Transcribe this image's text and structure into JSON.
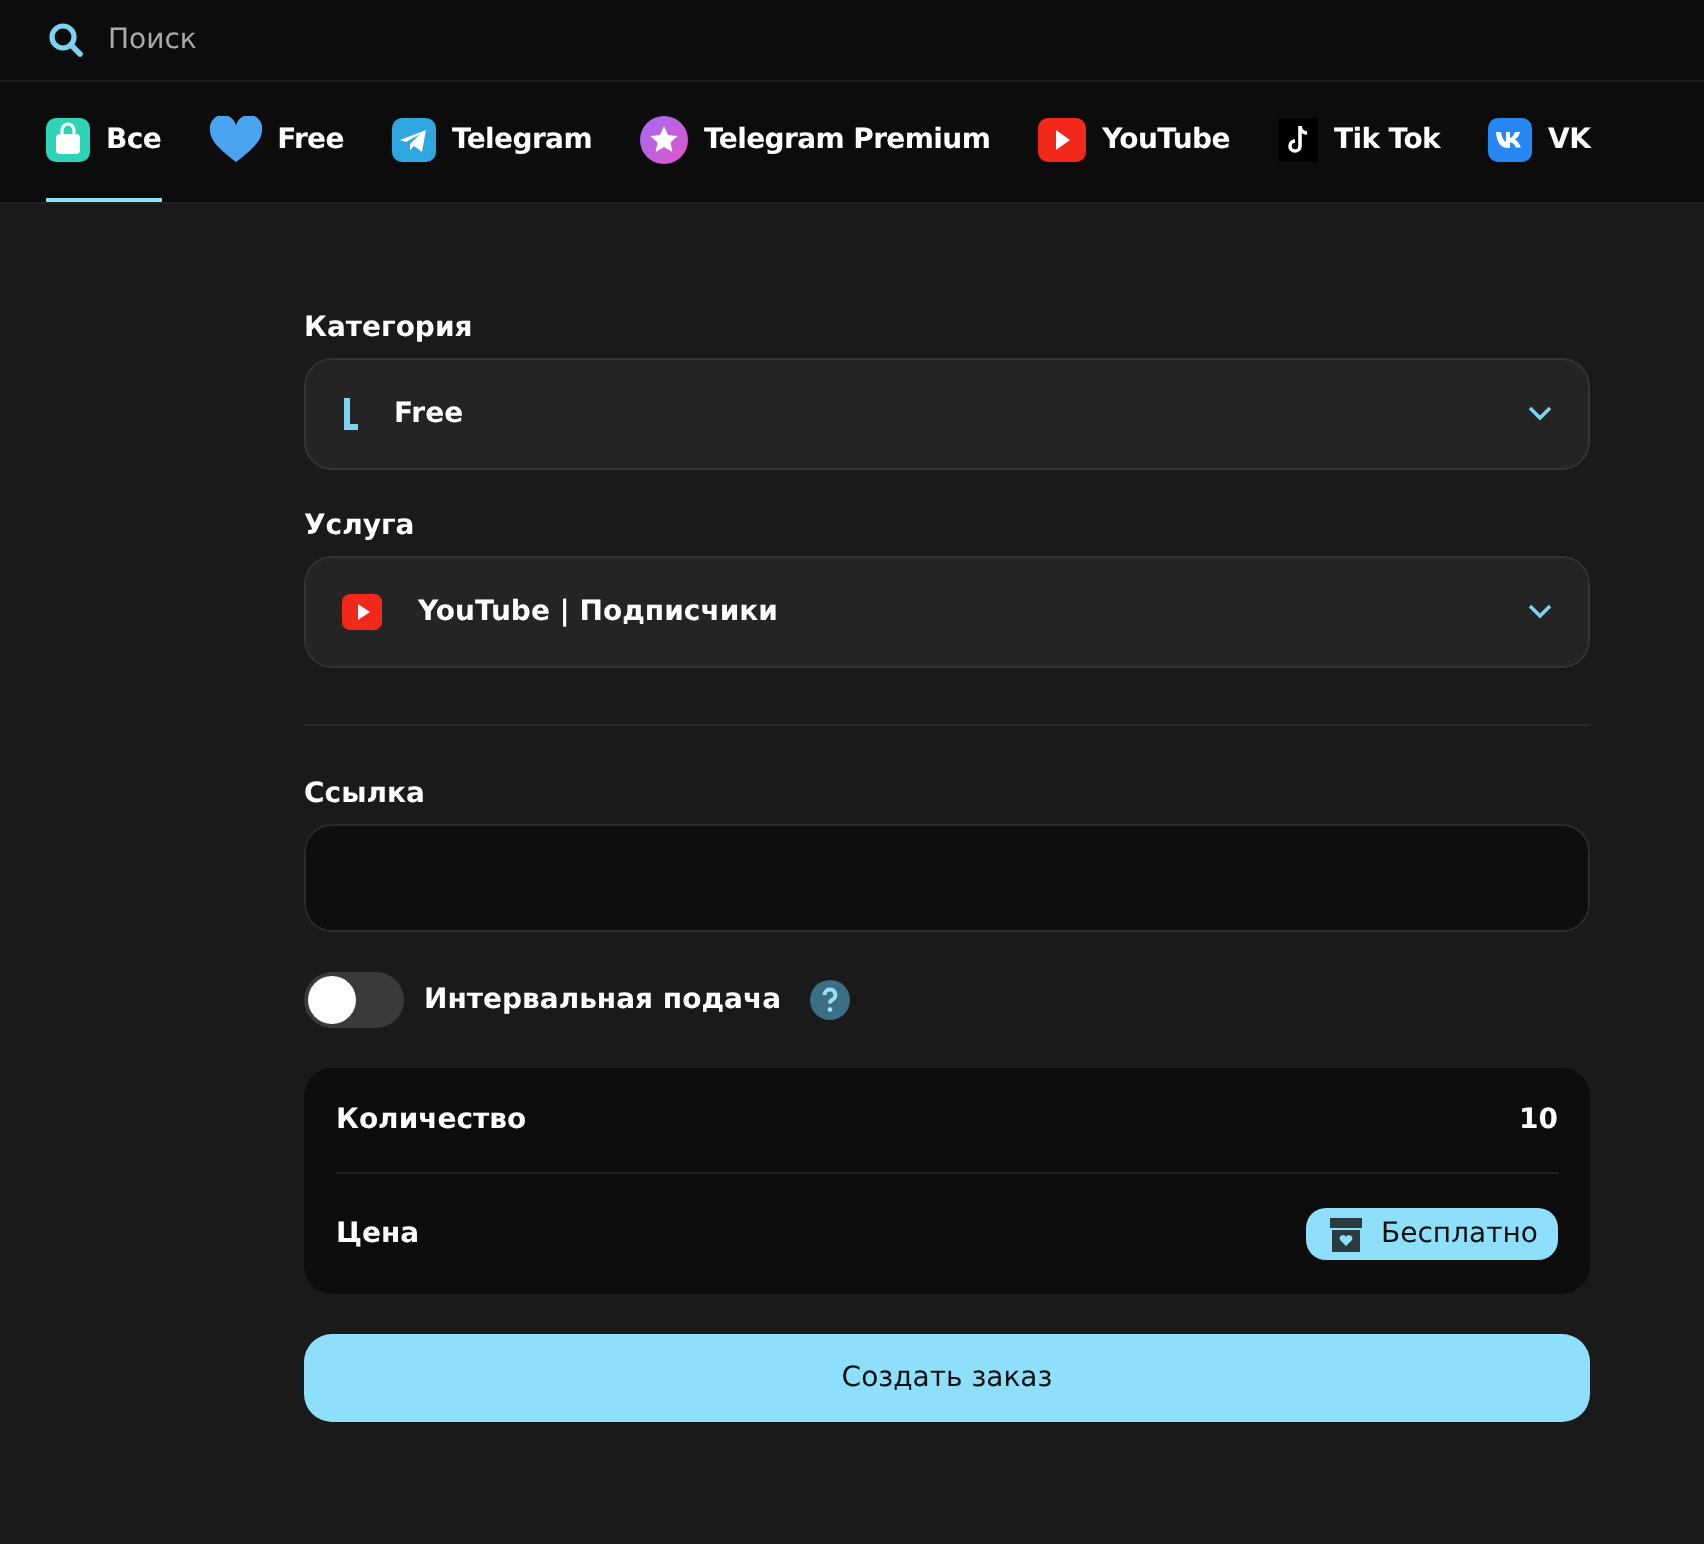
{
  "search": {
    "placeholder": "Поиск"
  },
  "tabs": [
    {
      "label": "Все",
      "kind": "bag",
      "selected": true
    },
    {
      "label": "Free",
      "kind": "heart",
      "selected": false
    },
    {
      "label": "Telegram",
      "kind": "telegram",
      "selected": false
    },
    {
      "label": "Telegram Premium",
      "kind": "star",
      "selected": false
    },
    {
      "label": "YouTube",
      "kind": "youtube",
      "selected": false
    },
    {
      "label": "Tik Tok",
      "kind": "tiktok",
      "selected": false
    },
    {
      "label": "VK",
      "kind": "vk",
      "selected": false
    }
  ],
  "category": {
    "label": "Категория",
    "value": "Free",
    "kind": "bar"
  },
  "service": {
    "label": "Услуга",
    "value": "YouTube | Подписчики",
    "kind": "youtube"
  },
  "link": {
    "label": "Ссылка"
  },
  "interval": {
    "label": "Интервальная подача",
    "on": false
  },
  "summary": {
    "quantity_label": "Количество",
    "quantity": "10",
    "price_label": "Цена",
    "price": "Бесплатно"
  },
  "submit": "Создать заказ"
}
